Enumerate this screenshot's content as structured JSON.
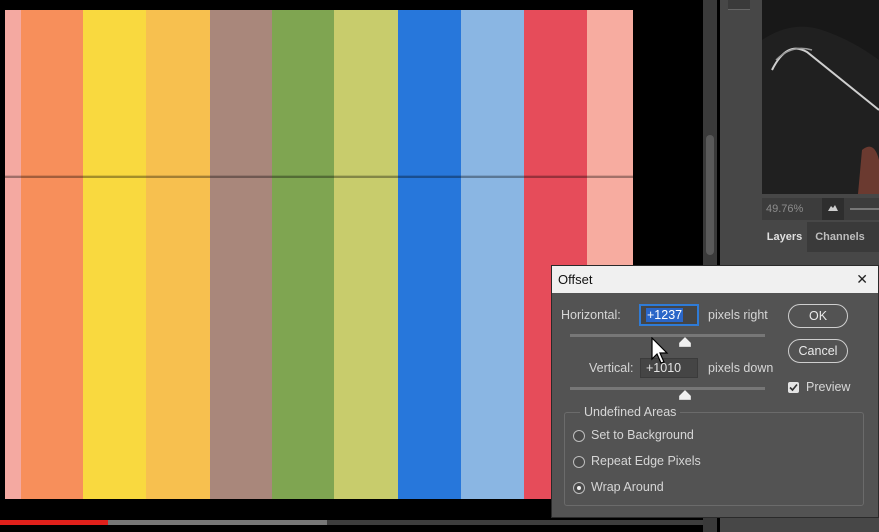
{
  "canvas": {
    "stripes": [
      {
        "color": "#f4a9a1"
      },
      {
        "color": "#f78f5b"
      },
      {
        "color": "#f9d93f"
      },
      {
        "color": "#f7c04f"
      },
      {
        "color": "#a9877b"
      },
      {
        "color": "#7fa551"
      },
      {
        "color": "#c8cc6c"
      },
      {
        "color": "#2777db"
      },
      {
        "color": "#8ab6e3"
      },
      {
        "color": "#e64c5a"
      },
      {
        "color": "#f7aca0"
      }
    ]
  },
  "navigator": {
    "zoom": "49.76%"
  },
  "panel_tabs": {
    "layers": "Layers",
    "channels": "Channels"
  },
  "video": {
    "played_fraction": 0.153,
    "loaded_fraction": 0.465
  },
  "dialog": {
    "title": "Offset",
    "close_glyph": "✕",
    "horizontal": {
      "label": "Horizontal:",
      "value": "+1237",
      "unit": "pixels right",
      "slider_fraction": 0.59
    },
    "vertical": {
      "label": "Vertical:",
      "value": "+1010",
      "unit": "pixels down",
      "slider_fraction": 0.59
    },
    "ok_label": "OK",
    "cancel_label": "Cancel",
    "preview_label": "Preview",
    "preview_checked": true,
    "undefined_areas": {
      "title": "Undefined Areas",
      "options": [
        {
          "label": "Set to Background",
          "selected": false
        },
        {
          "label": "Repeat Edge Pixels",
          "selected": false
        },
        {
          "label": "Wrap Around",
          "selected": true
        }
      ]
    }
  }
}
